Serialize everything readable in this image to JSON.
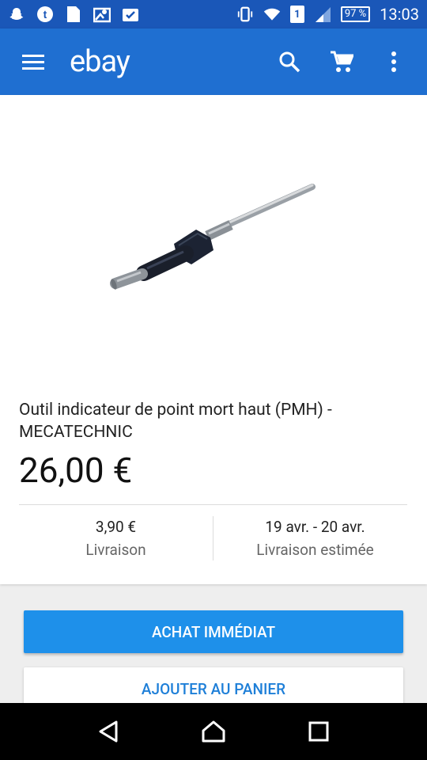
{
  "status_bar": {
    "battery": "97 %",
    "sim": "1",
    "time": "13:03"
  },
  "app_bar": {
    "logo": "ebay",
    "menu_icon": "hamburger-menu-icon",
    "search_icon": "search-icon",
    "cart_icon": "cart-icon",
    "more_icon": "more-vert-icon"
  },
  "product": {
    "title": "Outil indicateur de point mort haut (PMH) - MECATECHNIC",
    "price": "26,00 €",
    "shipping_cost": "3,90 €",
    "shipping_label": "Livraison",
    "delivery_dates": "19 avr. - 20 avr.",
    "delivery_label": "Livraison estimée"
  },
  "actions": {
    "buy_now": "ACHAT IMMÉDIAT",
    "add_to_cart": "AJOUTER AU PANIER"
  },
  "colors": {
    "status_bar": "#1a57b8",
    "app_bar": "#1f6fd1",
    "primary_button": "#1e90ea",
    "secondary_text": "#1e7fd8"
  }
}
